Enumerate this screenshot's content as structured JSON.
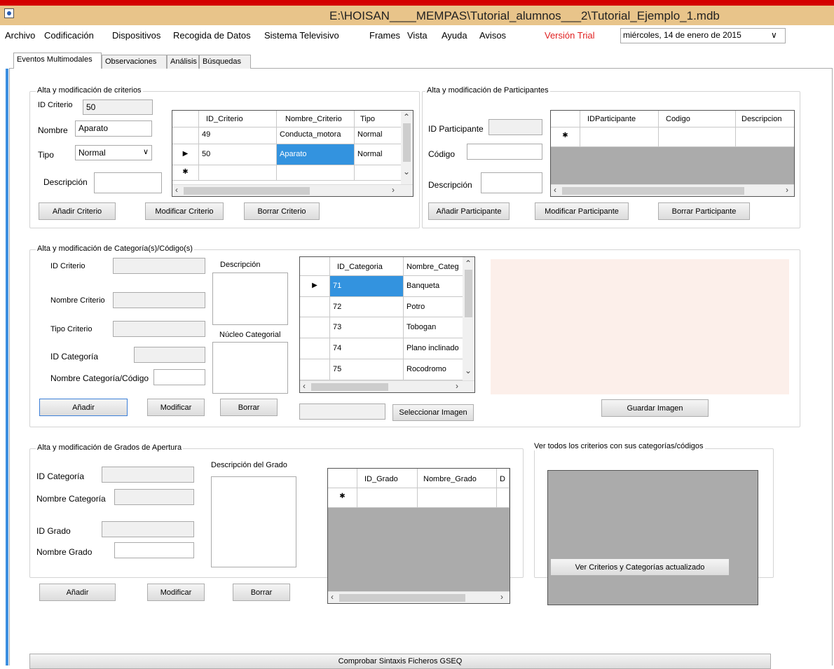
{
  "window": {
    "title": "E:\\HOISAN____MEMPAS\\Tutorial_alumnos___2\\Tutorial_Ejemplo_1.mdb"
  },
  "menu": {
    "items": [
      "Archivo",
      "Codificación",
      "Dispositivos",
      "Recogida de Datos",
      "Sistema Televisivo",
      "Frames",
      "Vista",
      "Ayuda",
      "Avisos"
    ],
    "trial": "Versión Trial",
    "date": "miércoles, 14 de   enero   de 2015",
    "date_chevron": "∨"
  },
  "tabs": [
    "Eventos Multimodales",
    "Observaciones",
    "Análisis",
    "Búsquedas"
  ],
  "criterios": {
    "title": "Alta y modificación de criterios",
    "id_label": "ID Criterio",
    "id_value": "50",
    "nombre_label": "Nombre",
    "nombre_value": "Aparato",
    "tipo_label": "Tipo",
    "tipo_value": "Normal",
    "desc_label": "Descripción",
    "desc_value": "",
    "grid": {
      "headers": [
        "ID_Criterio",
        "Nombre_Criterio",
        "Tipo"
      ],
      "rows": [
        {
          "marker": "",
          "id": "49",
          "nombre": "Conducta_motora",
          "tipo": "Normal"
        },
        {
          "marker": "▶",
          "id": "50",
          "nombre": "Aparato",
          "tipo": "Normal"
        },
        {
          "marker": "✱",
          "id": "",
          "nombre": "",
          "tipo": ""
        }
      ]
    },
    "buttons": {
      "add": "Añadir Criterio",
      "modify": "Modificar Criterio",
      "delete": "Borrar Criterio"
    }
  },
  "participantes": {
    "title": "Alta y modificación de Participantes",
    "id_label": "ID Participante",
    "codigo_label": "Código",
    "desc_label": "Descripción",
    "grid": {
      "headers": [
        "IDParticipante",
        "Codigo",
        "Descripcion"
      ],
      "new_marker": "✱"
    },
    "buttons": {
      "add": "Añadir Participante",
      "modify": "Modificar Participante",
      "delete": "Borrar Participante"
    }
  },
  "categorias": {
    "title": "Alta y modificación de Categoría(s)/Código(s)",
    "id_criterio_label": "ID Criterio",
    "nombre_criterio_label": "Nombre Criterio",
    "tipo_criterio_label": "Tipo Criterio",
    "id_categoria_label": "ID Categoría",
    "nombre_categoria_label": "Nombre Categoría/Código",
    "desc_label": "Descripción",
    "nucleo_label": "Núcleo Categorial",
    "grid": {
      "headers": [
        "ID_Categoria",
        "Nombre_Categ"
      ],
      "rows": [
        {
          "marker": "▶",
          "id": "71",
          "nombre": "Banqueta"
        },
        {
          "marker": "",
          "id": "72",
          "nombre": "Potro"
        },
        {
          "marker": "",
          "id": "73",
          "nombre": "Tobogan"
        },
        {
          "marker": "",
          "id": "74",
          "nombre": "Plano inclinado"
        },
        {
          "marker": "",
          "id": "75",
          "nombre": "Rocodromo"
        }
      ]
    },
    "buttons": {
      "add": "Añadir",
      "modify": "Modificar",
      "delete": "Borrar",
      "select_image": "Seleccionar Imagen",
      "save_image": "Guardar Imagen"
    }
  },
  "grados": {
    "title": "Alta y modificación de Grados de Apertura",
    "id_categoria_label": "ID Categoría",
    "nombre_categoria_label": "Nombre Categoría",
    "id_grado_label": "ID Grado",
    "nombre_grado_label": "Nombre Grado",
    "desc_label": "Descripción del Grado",
    "grid": {
      "headers": [
        "ID_Grado",
        "Nombre_Grado",
        "D"
      ],
      "new_marker": "✱"
    },
    "buttons": {
      "add": "Añadir",
      "modify": "Modificar",
      "delete": "Borrar"
    }
  },
  "ver_todos": {
    "title": "Ver todos los criterios con sus categorías/códigos",
    "button": "Ver Criterios y Categorías actualizado"
  },
  "footer": {
    "button": "Comprobar Sintaxis Ficheros GSEQ"
  },
  "colors": {
    "title_bar": "#e8c48a",
    "top_strip": "#d40000",
    "selection": "#3393df",
    "image_area": "#fcefea",
    "trial_text": "#e02020"
  }
}
